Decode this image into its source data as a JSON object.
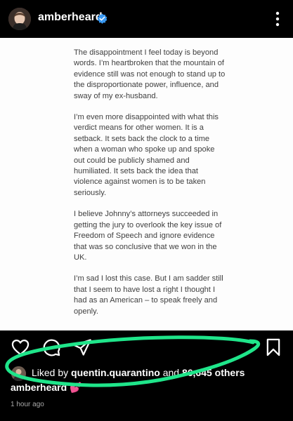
{
  "header": {
    "username": "amberheard",
    "verified_icon": "verified-badge-icon",
    "menu_icon": "more-options-icon",
    "verified_color": "#3897f0"
  },
  "post": {
    "statement_paragraphs": [
      "The disappointment I feel today is beyond words. I’m heartbroken that the mountain of evidence still was not enough to stand up to the disproportionate power, influence, and sway of my ex-husband.",
      "I’m even more disappointed with what this verdict means for other women. It is a setback. It sets back the clock to a time when a woman who spoke up and spoke out could be publicly shamed and humiliated. It sets back the idea that violence against women is to be taken seriously.",
      "I believe Johnny’s attorneys succeeded in getting the jury to overlook the key issue of Freedom of Speech and ignore evidence that was so conclusive that we won in the UK.",
      "I’m sad I lost this case. But I am sadder still that I seem to have lost a right I thought I had as an American – to speak freely and openly."
    ]
  },
  "actions": {
    "like_icon": "heart-icon",
    "comment_icon": "comment-icon",
    "share_icon": "send-icon",
    "save_icon": "bookmark-icon"
  },
  "likes": {
    "prefix": "Liked by ",
    "liker": "quentin.quarantino",
    "middle": " and ",
    "count": "86,645",
    "suffix": " others"
  },
  "caption": {
    "username": "amberheard",
    "emoji": "💕"
  },
  "timestamp": "1 hour ago",
  "annotation_color": "#1fe58a"
}
